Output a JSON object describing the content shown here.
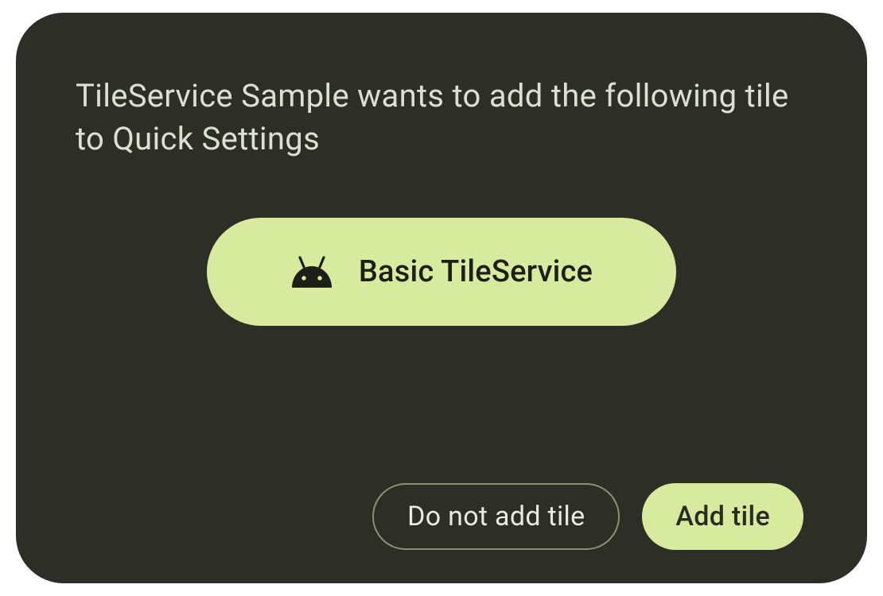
{
  "dialog": {
    "title": "TileService Sample wants to add the following tile to Quick Settings",
    "tile": {
      "icon_name": "android-icon",
      "label": "Basic TileService"
    },
    "buttons": {
      "deny_label": "Do not add tile",
      "confirm_label": "Add tile"
    }
  },
  "colors": {
    "dialog_bg": "#2d2e25",
    "accent": "#d7ea9d",
    "text_primary": "#dbe0d3",
    "text_on_accent": "#1d1e17",
    "outline": "#8b9270"
  }
}
